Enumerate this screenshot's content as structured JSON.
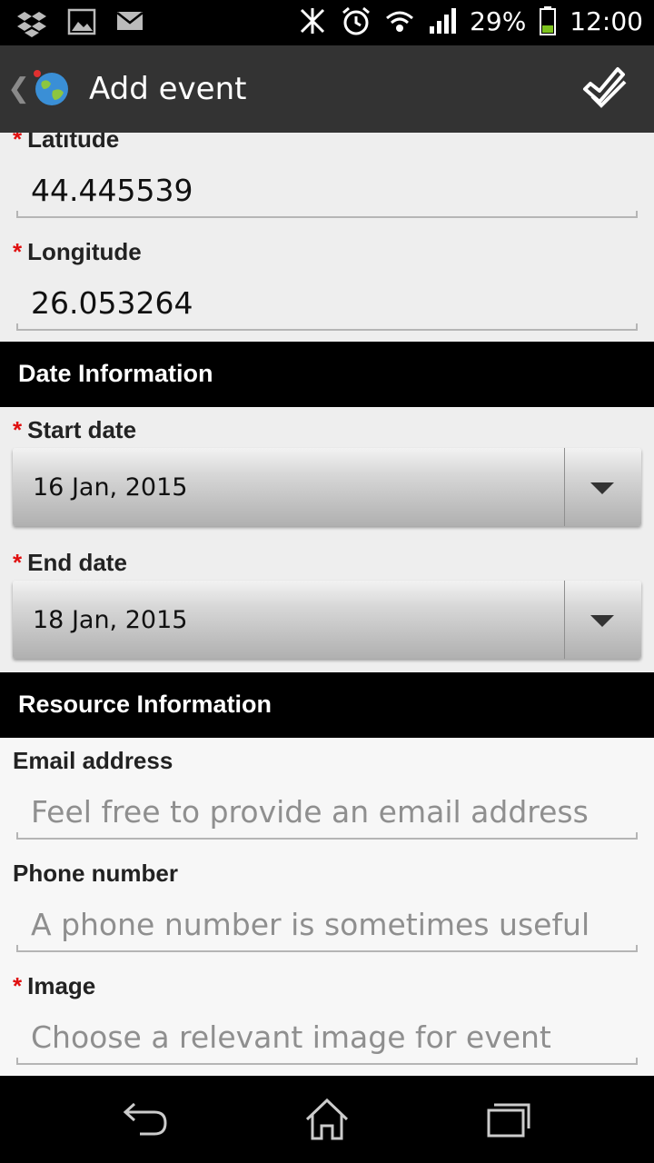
{
  "status_bar": {
    "battery_percent": "29%",
    "time": "12:00",
    "left_icons": [
      "dropbox-icon",
      "image-icon",
      "gmail-icon"
    ],
    "right_icons": [
      "nfc-icon",
      "alarm-icon",
      "wifi-icon",
      "signal-icon",
      "battery-icon"
    ]
  },
  "action_bar": {
    "title": "Add event"
  },
  "form": {
    "latitude": {
      "label": "Latitude",
      "required": true,
      "value": "44.445539"
    },
    "longitude": {
      "label": "Longitude",
      "required": true,
      "value": "26.053264"
    },
    "date_section": "Date Information",
    "start_date": {
      "label": "Start date",
      "required": true,
      "value": "16 Jan, 2015"
    },
    "end_date": {
      "label": "End date",
      "required": true,
      "value": "18 Jan, 2015"
    },
    "resource_section": "Resource Information",
    "email": {
      "label": "Email address",
      "required": false,
      "placeholder": "Feel free to provide an email address"
    },
    "phone": {
      "label": "Phone number",
      "required": false,
      "placeholder": "A phone number is sometimes useful"
    },
    "image": {
      "label": "Image",
      "required": true,
      "placeholder": "Choose a relevant image for event"
    }
  },
  "colors": {
    "required_marker": "#e01010",
    "action_bar": "#333333",
    "section_header": "#000000"
  }
}
